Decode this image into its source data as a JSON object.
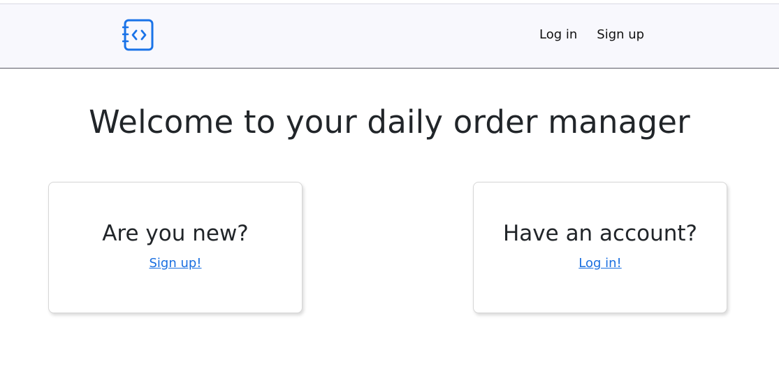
{
  "header": {
    "logo_icon": "code-notebook-icon",
    "accent_color": "#1a73e8",
    "nav": {
      "login_label": "Log in",
      "signup_label": "Sign up"
    }
  },
  "main": {
    "title": "Welcome to your daily order manager",
    "cards": {
      "new_user": {
        "heading": "Are you new?",
        "link_label": "Sign up!"
      },
      "existing_user": {
        "heading": "Have an account?",
        "link_label": "Log in!"
      }
    }
  },
  "colors": {
    "navbar_bg": "#f8f8fd",
    "link": "#1a6fe0",
    "text": "#212529"
  }
}
